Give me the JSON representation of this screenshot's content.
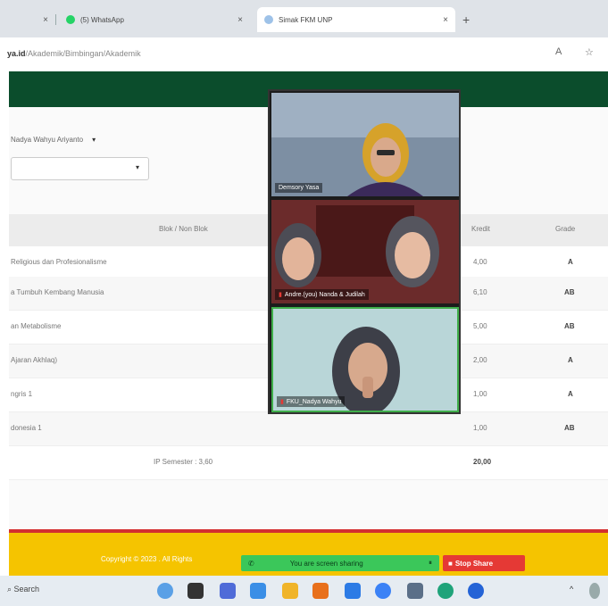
{
  "browser": {
    "tabs": [
      {
        "label": "",
        "close": "×"
      },
      {
        "label": "(5) WhatsApp",
        "close": "×"
      },
      {
        "label": "Simak FKM UNP",
        "close": "×"
      }
    ],
    "new_tab": "+",
    "url_bold": "ya.id",
    "url_path": "/Akademik/Bimbingan/Akademik"
  },
  "filters": {
    "student_select": "Nadya Wahyu Ariyanto",
    "arrow": "▾",
    "second_arrow": "▾"
  },
  "table": {
    "headers": {
      "blok": "Blok / Non Blok",
      "kredit": "Kredit",
      "grade": "Grade"
    },
    "rows": [
      {
        "course": "Religious dan Profesionalisme",
        "kredit": "4,00",
        "grade": "A"
      },
      {
        "course": "a Tumbuh Kembang Manusia",
        "kredit": "6,10",
        "grade": "AB"
      },
      {
        "course": "an Metabolisme",
        "kredit": "5,00",
        "grade": "AB"
      },
      {
        "course": "Ajaran Akhlaq)",
        "kredit": "2,00",
        "grade": "A"
      },
      {
        "course": "ngris 1",
        "kredit": "1,00",
        "grade": "A"
      },
      {
        "course": "donesia 1",
        "kredit": "1,00",
        "grade": "AB"
      }
    ],
    "ip_label": "IP Semester : 3,60",
    "total_kredit": "20,00"
  },
  "footer": {
    "copyright": "Copyright © 2023 . All Rights"
  },
  "screen_share": {
    "message": "You are screen sharing",
    "stop_label": "Stop Share"
  },
  "video": {
    "tile1_name": "Demsory Yasa",
    "tile2_name": "Andre.(you) Nanda & Judilah",
    "tile3_name": "FKU_Nadya Wahyu"
  },
  "taskbar": {
    "search": "Search",
    "tray_arrow": "^"
  }
}
